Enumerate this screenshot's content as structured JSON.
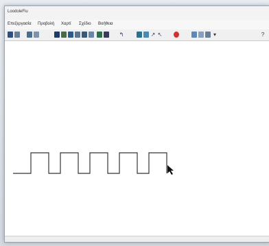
{
  "window": {
    "title": "LoodoleFiu"
  },
  "menu": {
    "items": [
      "Επεξεργασία",
      "Προβολή",
      "Χαρτί",
      "Σχέδιο",
      "Βοήθεια"
    ]
  },
  "toolbar": {
    "buttons": [
      "save",
      "print",
      "cut",
      "copy",
      "pen",
      "eraser",
      "line",
      "draw",
      "fill",
      "shape",
      "play",
      "stop",
      "undo",
      "zoom",
      "pen-blue",
      "arrow",
      "pointer",
      "stop-sign",
      "brush",
      "eraser2",
      "help"
    ]
  },
  "drawing": {
    "type": "square-wave",
    "pulses": 5,
    "stroke": "#333333"
  }
}
